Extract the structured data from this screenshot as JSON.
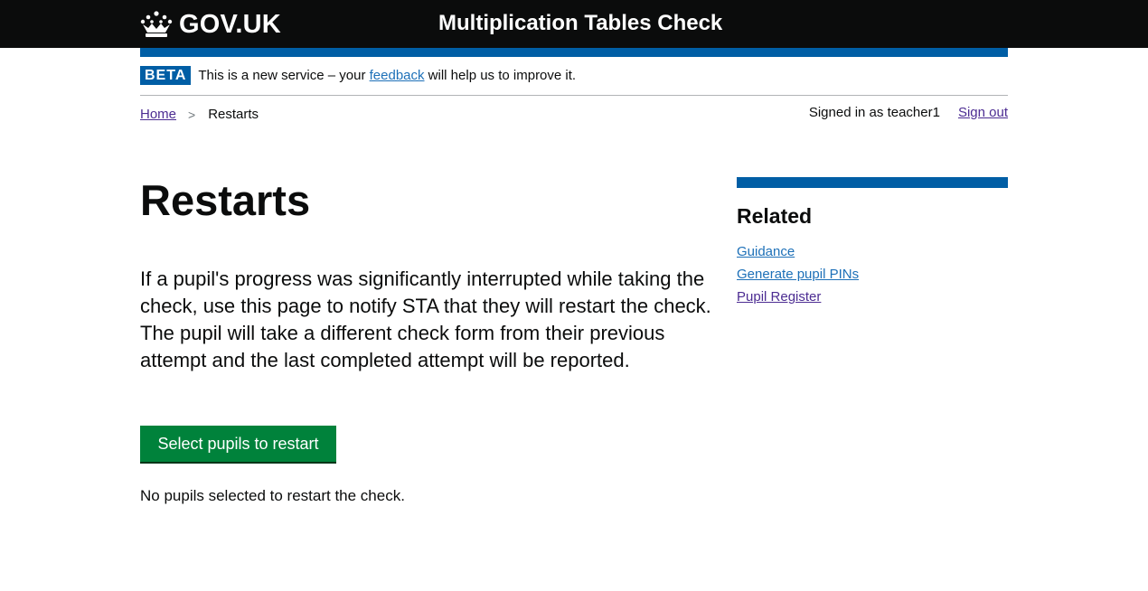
{
  "header": {
    "logo_text": "GOV.UK",
    "service_name": "Multiplication Tables Check"
  },
  "phase_banner": {
    "tag": "BETA",
    "text_before": "This is a new service – your ",
    "link_text": "feedback",
    "text_after": " will help us to improve it."
  },
  "breadcrumbs": {
    "home": "Home",
    "separator": ">",
    "current": "Restarts"
  },
  "account": {
    "signed_in_text": "Signed in as teacher1",
    "sign_out": "Sign out"
  },
  "main": {
    "title": "Restarts",
    "lead": "If a pupil's progress was significantly interrupted while taking the check, use this page to notify STA that they will restart the check. The pupil will take a different check form from their previous attempt and the last completed attempt will be reported.",
    "button_label": "Select pupils to restart",
    "status_text": "No pupils selected to restart the check."
  },
  "related": {
    "heading": "Related",
    "links": [
      {
        "label": "Guidance"
      },
      {
        "label": "Generate pupil PINs"
      },
      {
        "label": "Pupil Register"
      }
    ]
  },
  "colors": {
    "header_bg": "#0b0c0c",
    "brand_blue": "#005ea5",
    "link": "#1d70b8",
    "link_visited": "#4c2c92",
    "button_green": "#00823b"
  },
  "icons": {
    "logo": "crown-icon"
  }
}
